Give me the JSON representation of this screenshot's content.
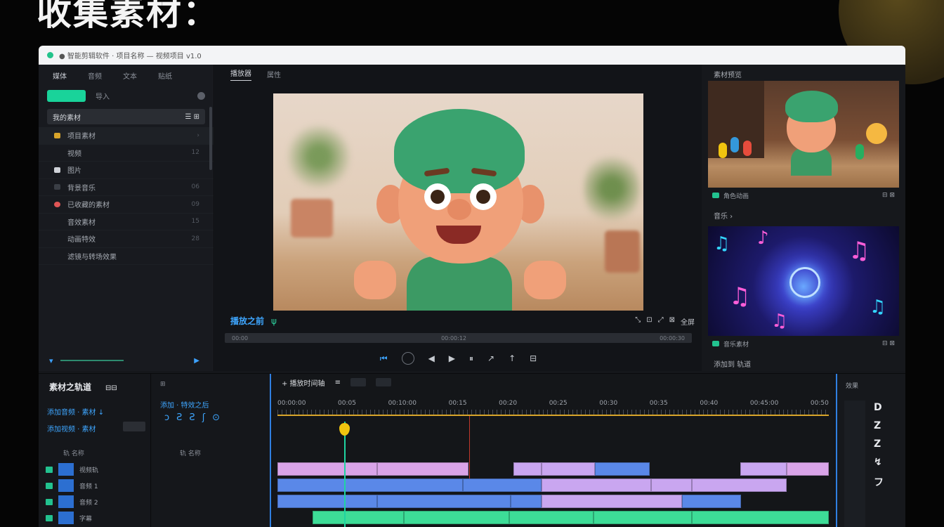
{
  "headline": "收集素材：",
  "window": {
    "title": "● 智能剪辑软件 · 项目名称 — 视频项目 v1.0"
  },
  "left_panel": {
    "tabs": [
      "媒体",
      "音频",
      "文本",
      "贴纸"
    ],
    "import_label": "导入",
    "library_header": "我的素材",
    "library_header_right": "☰ ⊞",
    "items": [
      {
        "label": "项目素材",
        "count": "›",
        "color": "#d8a42a"
      },
      {
        "label": "视频",
        "count": "12",
        "color": "#15171b"
      },
      {
        "label": "图片",
        "count": "",
        "color": "#cfd2d8"
      },
      {
        "label": "背景音乐",
        "count": "06",
        "color": "#3a3e45"
      },
      {
        "label": "已收藏的素材",
        "count": "09",
        "color": "#e05555"
      },
      {
        "label": "音效素材",
        "count": "15",
        "color": "#15171b"
      },
      {
        "label": "动画特效",
        "count": "28",
        "color": "#15171b"
      },
      {
        "label": "滤镜与转场效果",
        "count": "",
        "color": "#15171b"
      }
    ]
  },
  "preview": {
    "tabs": [
      "播放器",
      "属性"
    ],
    "caption": "播放之前",
    "caption_tag": "ψ",
    "right_icons": [
      "⤡",
      "⊡",
      "⤢",
      "⊠",
      "全屏"
    ],
    "scrub_left": "00:00",
    "scrub_mid": "00:00:12",
    "scrub_right": "00:00:30",
    "transport": [
      "⏮",
      "◀",
      "▶",
      "⏸",
      "↗",
      "↑",
      "⊟"
    ]
  },
  "right_panel": {
    "label1": "素材预览",
    "thumb1_caption": "角色动画",
    "thumb1_end": "⊟ ⊠",
    "label2": "音乐 ›",
    "thumb2_caption": "音乐素材",
    "thumb2_end": "⊟ ⊠",
    "footer": "添加到 轨道"
  },
  "timeline": {
    "left_header": "素材之轨道",
    "left_sub": "⊟⊟",
    "left_blue1": "添加音频 · 素材  ↓",
    "left_blue2": "添加视频 · 素材",
    "left_cols": "轨  名称",
    "tracks": [
      {
        "label": "视频轨"
      },
      {
        "label": "音频 1"
      },
      {
        "label": "音频 2"
      },
      {
        "label": "字幕"
      }
    ],
    "mid_header": "⊞",
    "mid_label": "添加 · 特效之后",
    "mid_icons": [
      "ↄ",
      "Ƨ",
      "Ƨ",
      "ʃ",
      "⊙"
    ],
    "mid_cols": "轨  名称",
    "tab_title": "+ 播放时间轴",
    "ruler": [
      "00:00:00",
      "00:05",
      "00:10:00",
      "00:15",
      "00:20",
      "00:25",
      "00:30",
      "00:35",
      "00:40",
      "00:45:00",
      "00:50"
    ],
    "right_header": "效果",
    "right_icons": [
      "D",
      "Z",
      "Z",
      "↯",
      "フ"
    ]
  }
}
